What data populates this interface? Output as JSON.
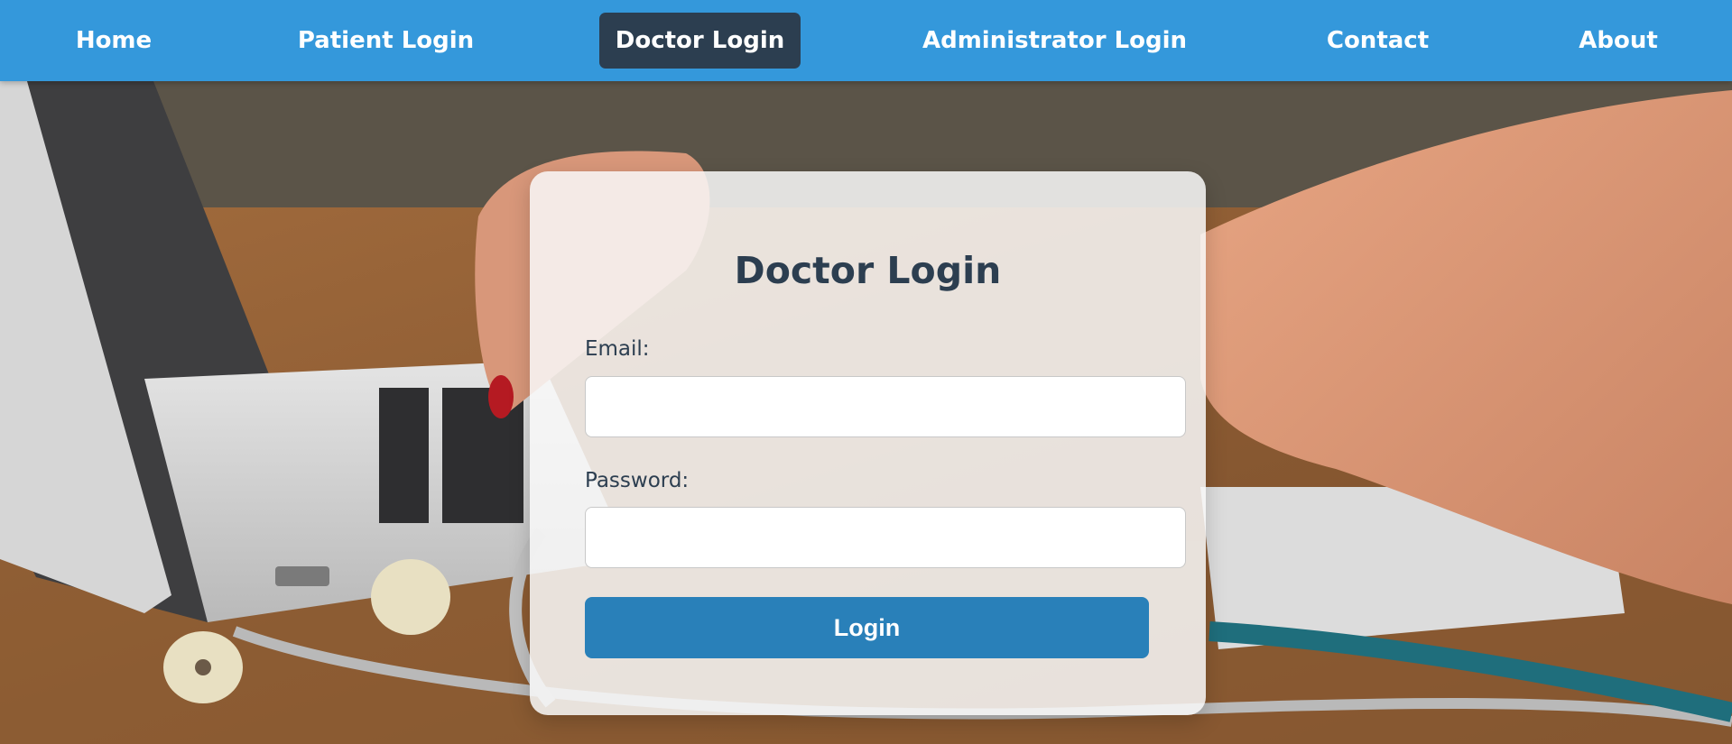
{
  "nav": {
    "items": [
      {
        "label": "Home",
        "active": false
      },
      {
        "label": "Patient Login",
        "active": false
      },
      {
        "label": "Doctor Login",
        "active": true
      },
      {
        "label": "Administrator Login",
        "active": false
      },
      {
        "label": "Contact",
        "active": false
      },
      {
        "label": "About",
        "active": false
      }
    ]
  },
  "login": {
    "title": "Doctor Login",
    "email_label": "Email:",
    "email_value": "",
    "password_label": "Password:",
    "password_value": "",
    "button_label": "Login"
  },
  "colors": {
    "navbar": "#3498db",
    "nav_active": "#2c3e50",
    "button": "#2980b9",
    "heading": "#2c3e50"
  }
}
